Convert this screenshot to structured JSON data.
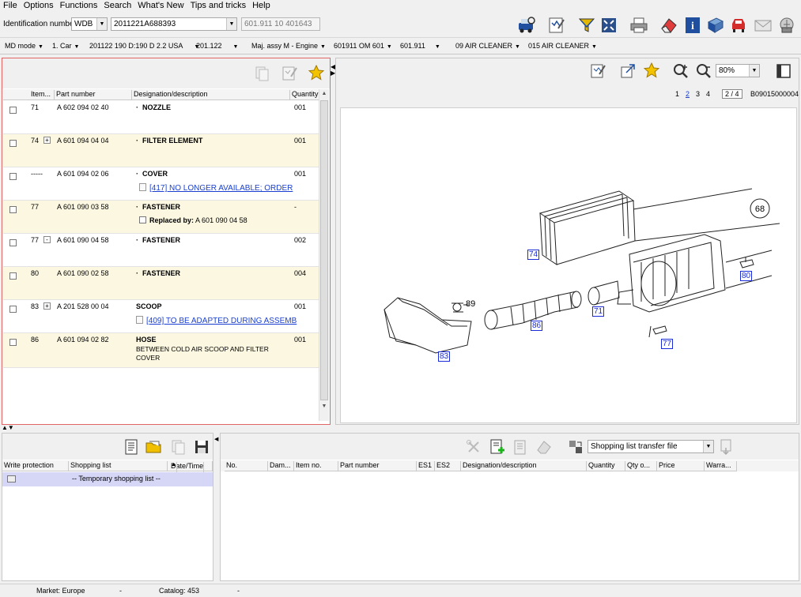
{
  "menu": [
    "File",
    "Options",
    "Functions",
    "Search",
    "What's New",
    "Tips and tricks",
    "Help"
  ],
  "identification": {
    "label": "Identification number",
    "prefix": "WDB",
    "vin": "2011221A688393",
    "engine_ref": "601.911 10 401643"
  },
  "breadcrumbs": [
    "MD mode",
    "1. Car",
    "201122 190 D:190 D 2.2 USA",
    "201.122",
    "Maj. assy M  - Engine",
    "601911 OM 601",
    "601.911",
    "09 AIR CLEANER",
    "015 AIR CLEANER"
  ],
  "parts_table": {
    "headers": [
      "Item...",
      "Part number",
      "Designation/description",
      "Quantity"
    ],
    "rows": [
      {
        "item": "71",
        "expander": "",
        "part_number": "A 602 094 02 40",
        "designation": "NOZZLE",
        "quantity": "001",
        "note": "",
        "replaced_label": "",
        "replaced_by": "",
        "subtext": ""
      },
      {
        "item": "74",
        "expander": "+",
        "part_number": "A 601 094 04 04",
        "designation": "FILTER ELEMENT",
        "quantity": "001",
        "note": "",
        "replaced_label": "",
        "replaced_by": "",
        "subtext": ""
      },
      {
        "item": "-----",
        "expander": "",
        "part_number": "A 601 094 02 06",
        "designation": "COVER",
        "quantity": "001",
        "note": "[417] NO LONGER AVAILABLE; ORDER",
        "replaced_label": "",
        "replaced_by": "",
        "subtext": ""
      },
      {
        "item": "77",
        "expander": "",
        "part_number": "A 601 090 03 58",
        "designation": "FASTENER",
        "quantity": "-",
        "note": "",
        "replaced_label": "Replaced by:",
        "replaced_by": "A 601 090 04 58",
        "subtext": ""
      },
      {
        "item": "77",
        "expander": "-",
        "part_number": "A 601 090 04 58",
        "designation": "FASTENER",
        "quantity": "002",
        "note": "",
        "replaced_label": "",
        "replaced_by": "",
        "subtext": ""
      },
      {
        "item": "80",
        "expander": "",
        "part_number": "A 601 090 02 58",
        "designation": "FASTENER",
        "quantity": "004",
        "note": "",
        "replaced_label": "",
        "replaced_by": "",
        "subtext": ""
      },
      {
        "item": "83",
        "expander": "+",
        "part_number": "A 201 528 00 04",
        "designation": "SCOOP",
        "quantity": "001",
        "note": "[409] TO BE ADAPTED DURING ASSEMB",
        "replaced_label": "",
        "replaced_by": "",
        "subtext": ""
      },
      {
        "item": "86",
        "expander": "",
        "part_number": "A 601 094 02 82",
        "designation": "HOSE",
        "quantity": "001",
        "note": "",
        "replaced_label": "",
        "replaced_by": "",
        "subtext": "BETWEEN COLD AIR SCOOP AND FILTER COVER"
      }
    ]
  },
  "diagram": {
    "zoom": "80%",
    "pages": [
      "1",
      "2",
      "3",
      "4"
    ],
    "current_page": "2",
    "page_of": "2 / 4",
    "image_id": "B09015000004",
    "callouts": [
      "74",
      "71",
      "86",
      "83",
      "80",
      "77"
    ],
    "plain_labels": [
      "68",
      "89"
    ]
  },
  "shopping": {
    "headers": [
      "Write protection",
      "Shopping list",
      "Date/Time"
    ],
    "row_label": "-- Temporary shopping list --"
  },
  "transfer": {
    "select_value": "Shopping list transfer file",
    "headers": [
      "No.",
      "Dam...",
      "Item no.",
      "Part number",
      "ES1",
      "ES2",
      "Designation/description",
      "Quantity",
      "Qty o...",
      "Price",
      "Warra..."
    ]
  },
  "status": {
    "market_label": "Market: Europe",
    "market_sep": "-",
    "catalog_label": "Catalog: 453",
    "catalog_sep": "-"
  },
  "colors": {
    "accent_border": "#e06666",
    "callout_blue": "#1a2bd8",
    "row_alt": "#fbf7e1",
    "selected_row": "#d6d6f6"
  }
}
